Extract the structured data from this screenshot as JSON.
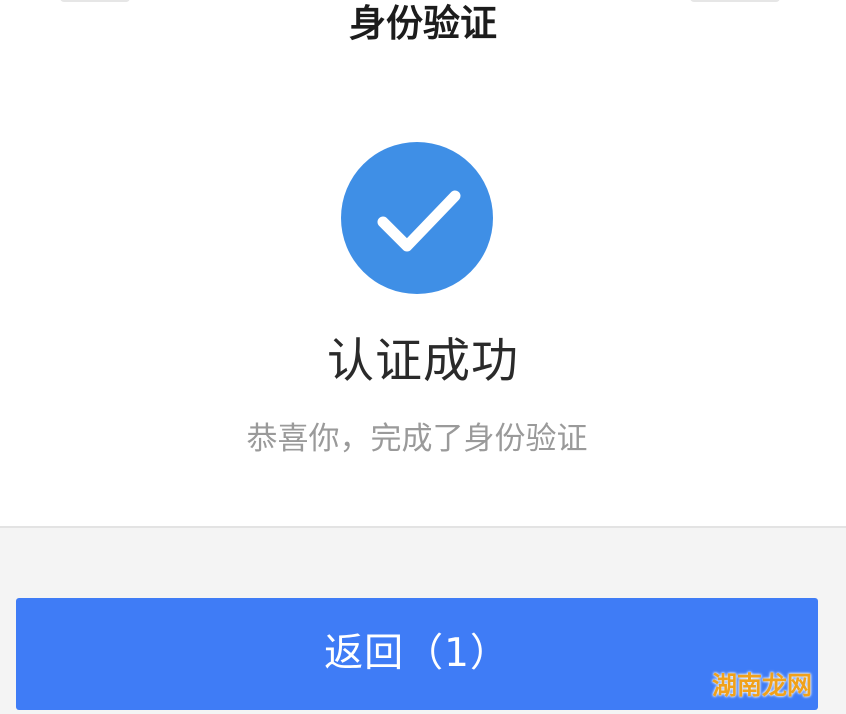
{
  "header": {
    "title": "身份验证"
  },
  "result": {
    "icon": "check-circle-icon",
    "title": "认证成功",
    "description": "恭喜你，完成了身份验证"
  },
  "actions": {
    "back_label": "返回（1）"
  },
  "watermark": {
    "text": "湖南龙网"
  },
  "colors": {
    "accent": "#3f8fe6",
    "button": "#3f7cf6",
    "muted_text": "#9a9a9a"
  }
}
